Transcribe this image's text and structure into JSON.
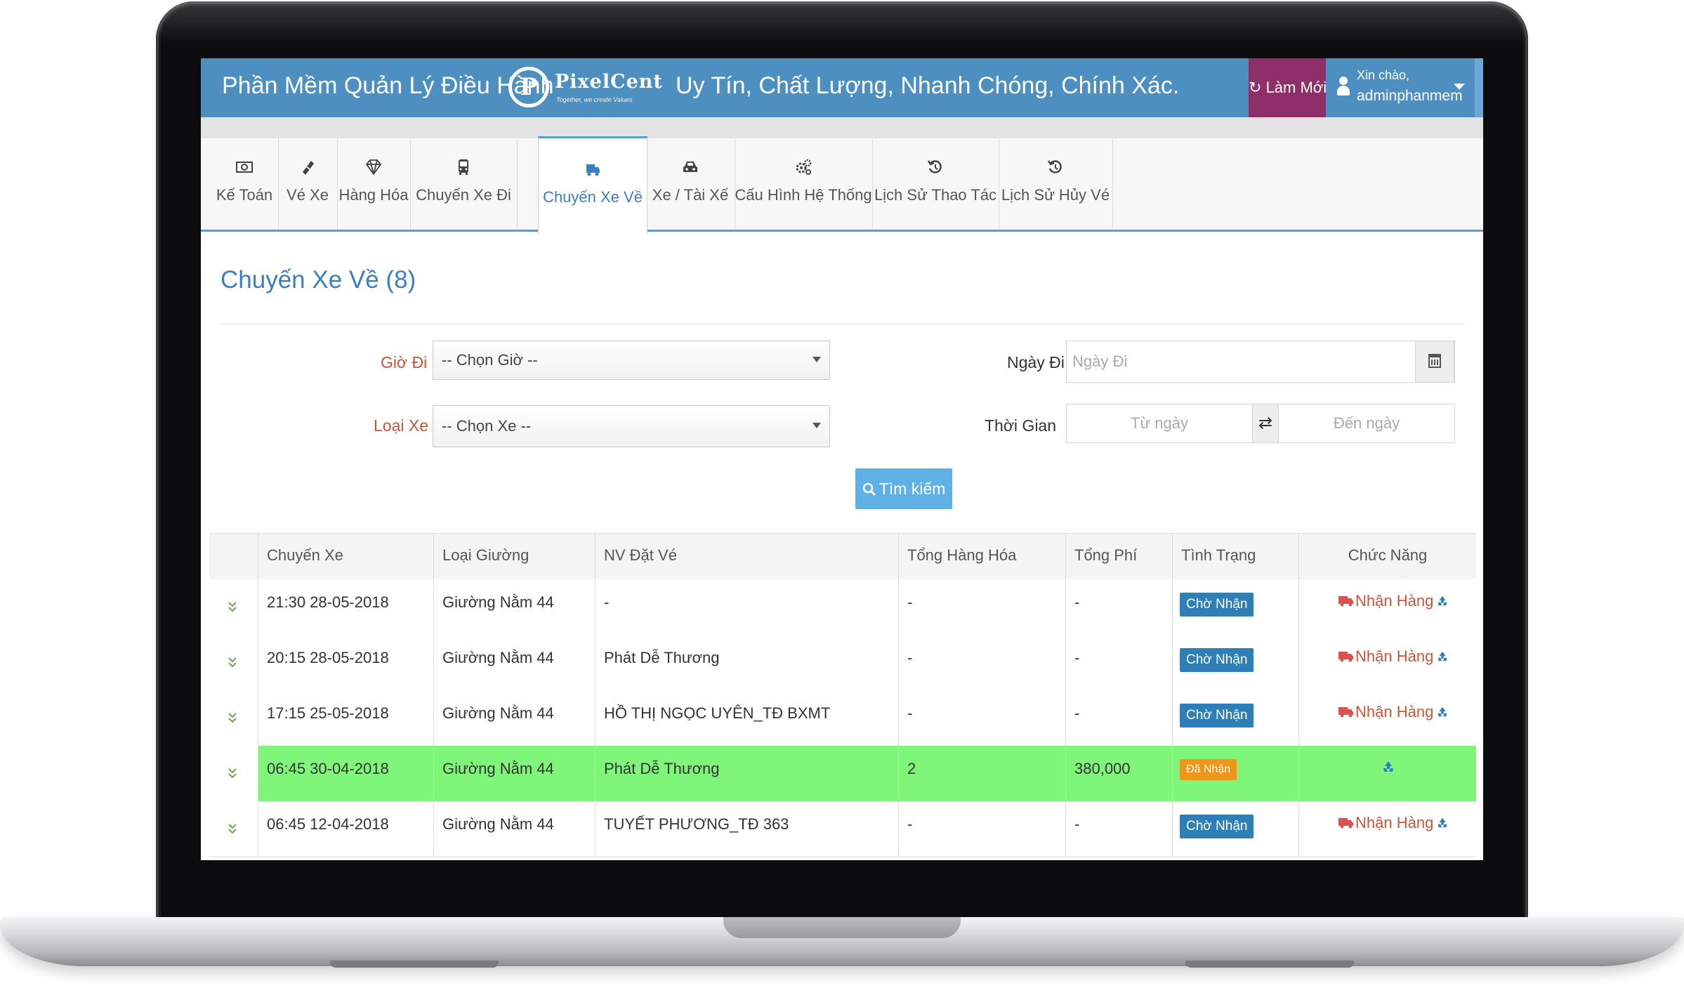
{
  "header": {
    "app_title": "Phần Mềm Quản Lý Điều Hành",
    "logo_name": "PixelCent",
    "logo_tagline": "Together, we create Values",
    "slogan": "Uy Tín, Chất Lượng, Nhanh Chóng, Chính Xác.",
    "refresh_label": "Làm Mới",
    "greeting": "Xin chào,",
    "username": "adminphanmem"
  },
  "tabs": [
    {
      "label": "Kế Toán",
      "icon": "money-icon"
    },
    {
      "label": "Vé Xe",
      "icon": "ticket-icon"
    },
    {
      "label": "Hàng Hóa",
      "icon": "diamond-icon"
    },
    {
      "label": "Chuyến Xe Đi",
      "icon": "bus-icon"
    },
    {
      "label": "Chuyến Xe Về",
      "icon": "truck-icon",
      "active": true
    },
    {
      "label": "Xe / Tài Xế",
      "icon": "car-icon"
    },
    {
      "label": "Cấu Hình Hệ Thống",
      "icon": "gears-icon"
    },
    {
      "label": "Lịch Sử Thao Tác",
      "icon": "history-icon"
    },
    {
      "label": "Lịch Sử Hủy Vé",
      "icon": "history-icon"
    }
  ],
  "page": {
    "title": "Chuyến Xe Về (8)"
  },
  "filters": {
    "gio_di_label": "Giờ Đi",
    "gio_di_value": "-- Chọn Giờ --",
    "loai_xe_label": "Loại Xe",
    "loai_xe_value": "-- Chọn Xe --",
    "ngay_di_label": "Ngày Đi",
    "ngay_di_placeholder": "Ngày Đi",
    "thoi_gian_label": "Thời Gian",
    "tu_ngay_placeholder": "Từ ngày",
    "den_ngay_placeholder": "Đến ngày",
    "search_label": "Tìm kiếm"
  },
  "table": {
    "columns": [
      "Chuyến Xe",
      "Loại Giường",
      "NV Đặt Vé",
      "Tổng Hàng Hóa",
      "Tổng Phí",
      "Tình Trạng",
      "Chức Năng"
    ],
    "rows": [
      {
        "chuyen_xe": "21:30 28-05-2018",
        "loai_giuong": "Giường Nằm 44",
        "nv_dat_ve": "-",
        "tong_hang_hoa": "-",
        "tong_phi": "-",
        "tinh_trang": "Chờ Nhận",
        "chuc_nang": "Nhận Hàng",
        "highlight": false
      },
      {
        "chuyen_xe": "20:15 28-05-2018",
        "loai_giuong": "Giường Nằm 44",
        "nv_dat_ve": "Phát Dễ Thương",
        "tong_hang_hoa": "-",
        "tong_phi": "-",
        "tinh_trang": "Chờ Nhận",
        "chuc_nang": "Nhận Hàng",
        "highlight": false
      },
      {
        "chuyen_xe": "17:15 25-05-2018",
        "loai_giuong": "Giường Nằm 44",
        "nv_dat_ve": "HỒ THỊ NGỌC UYÊN_TĐ BXMT",
        "tong_hang_hoa": "-",
        "tong_phi": "-",
        "tinh_trang": "Chờ Nhận",
        "chuc_nang": "Nhận Hàng",
        "highlight": false
      },
      {
        "chuyen_xe": "06:45 30-04-2018",
        "loai_giuong": "Giường Nằm 44",
        "nv_dat_ve": "Phát Dễ Thương",
        "tong_hang_hoa": "2",
        "tong_phi": "380,000",
        "tinh_trang": "Đã Nhận",
        "chuc_nang": "",
        "highlight": true
      },
      {
        "chuyen_xe": "06:45 12-04-2018",
        "loai_giuong": "Giường Nằm 44",
        "nv_dat_ve": "TUYẾT PHƯƠNG_TĐ 363",
        "tong_hang_hoa": "-",
        "tong_phi": "-",
        "tinh_trang": "Chờ Nhận",
        "chuc_nang": "Nhận Hàng",
        "highlight": false
      }
    ]
  },
  "colors": {
    "header_blue": "#4d8fc1",
    "refresh_purple": "#8e2f6a",
    "tab_active": "#3a7fc1",
    "label_red": "#c8553b",
    "search_button": "#5fb0e4",
    "badge_blue": "#2e7fb5",
    "badge_orange": "#f0961a",
    "row_highlight": "#7ff57a"
  }
}
